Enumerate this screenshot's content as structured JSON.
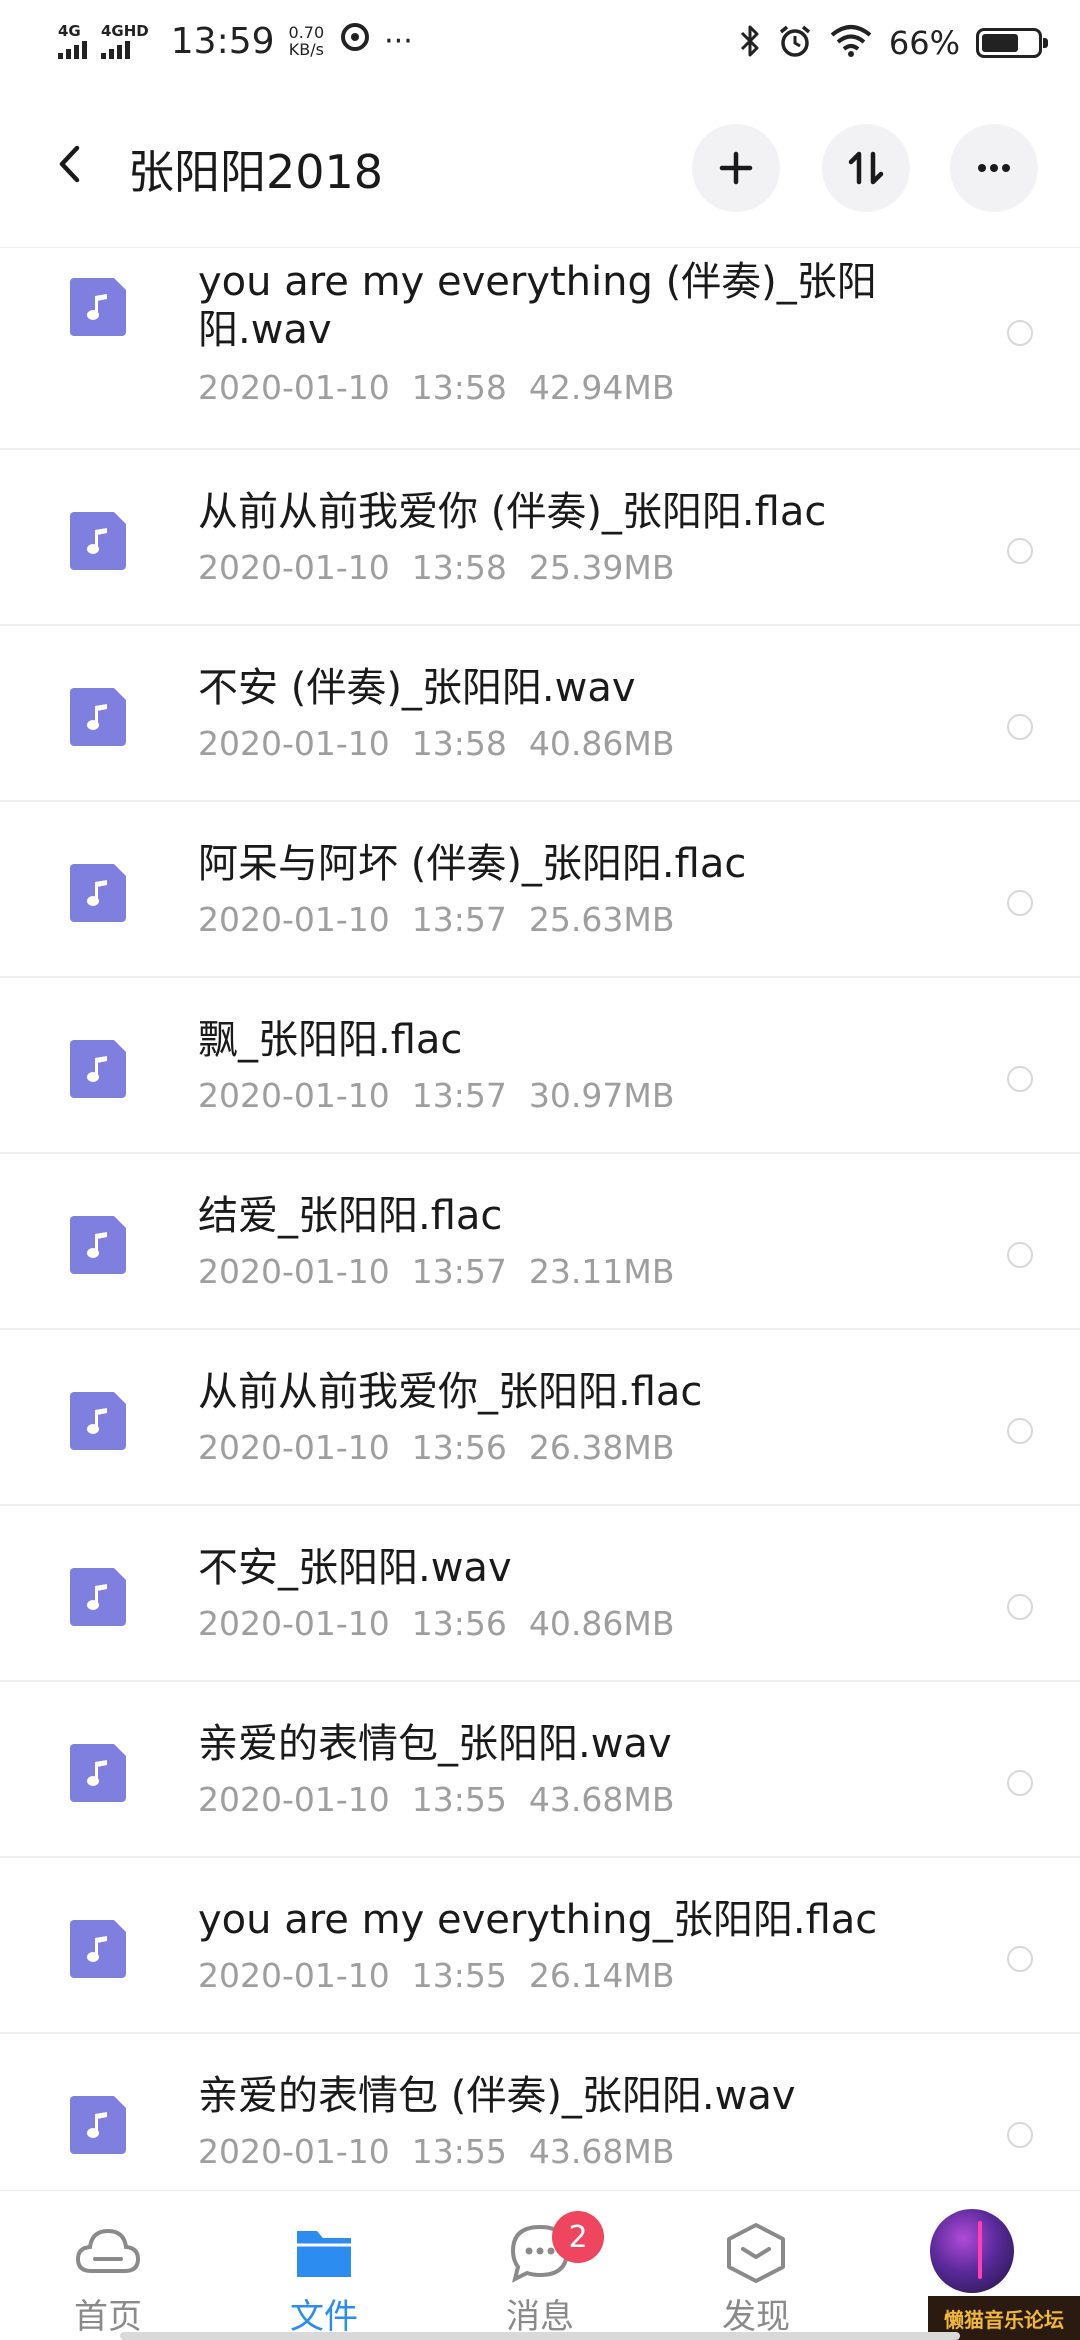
{
  "status_bar": {
    "signal_1": "4G",
    "signal_2": "4GHD",
    "time": "13:59",
    "speed_value": "0.70",
    "speed_unit": "KB/s",
    "more": "···",
    "battery_pct": "66%",
    "battery_level": 0.66
  },
  "header": {
    "title": "张阳阳2018"
  },
  "files": [
    {
      "name": "you are my everything (伴奏)_张阳阳.wav",
      "date": "2020-01-10",
      "time": "13:58",
      "size": "42.94MB"
    },
    {
      "name": "从前从前我爱你 (伴奏)_张阳阳.flac",
      "date": "2020-01-10",
      "time": "13:58",
      "size": "25.39MB"
    },
    {
      "name": "不安 (伴奏)_张阳阳.wav",
      "date": "2020-01-10",
      "time": "13:58",
      "size": "40.86MB"
    },
    {
      "name": "阿呆与阿坏 (伴奏)_张阳阳.flac",
      "date": "2020-01-10",
      "time": "13:57",
      "size": "25.63MB"
    },
    {
      "name": "飘_张阳阳.flac",
      "date": "2020-01-10",
      "time": "13:57",
      "size": "30.97MB"
    },
    {
      "name": "结爱_张阳阳.flac",
      "date": "2020-01-10",
      "time": "13:57",
      "size": "23.11MB"
    },
    {
      "name": "从前从前我爱你_张阳阳.flac",
      "date": "2020-01-10",
      "time": "13:56",
      "size": "26.38MB"
    },
    {
      "name": "不安_张阳阳.wav",
      "date": "2020-01-10",
      "time": "13:56",
      "size": "40.86MB"
    },
    {
      "name": "亲爱的表情包_张阳阳.wav",
      "date": "2020-01-10",
      "time": "13:55",
      "size": "43.68MB"
    },
    {
      "name": "you are my everything_张阳阳.flac",
      "date": "2020-01-10",
      "time": "13:55",
      "size": "26.14MB"
    },
    {
      "name": "亲爱的表情包 (伴奏)_张阳阳.wav",
      "date": "2020-01-10",
      "time": "13:55",
      "size": "43.68MB"
    }
  ],
  "nav": {
    "home": "首页",
    "files": "文件",
    "messages": "消息",
    "messages_badge": "2",
    "discover": "发现"
  },
  "watermark": "懒猫音乐论坛",
  "colors": {
    "accent": "#2d8cf0",
    "file_icon": "#7f7fe0",
    "badge": "#f0455e",
    "meta_text": "#9e9e9e"
  }
}
